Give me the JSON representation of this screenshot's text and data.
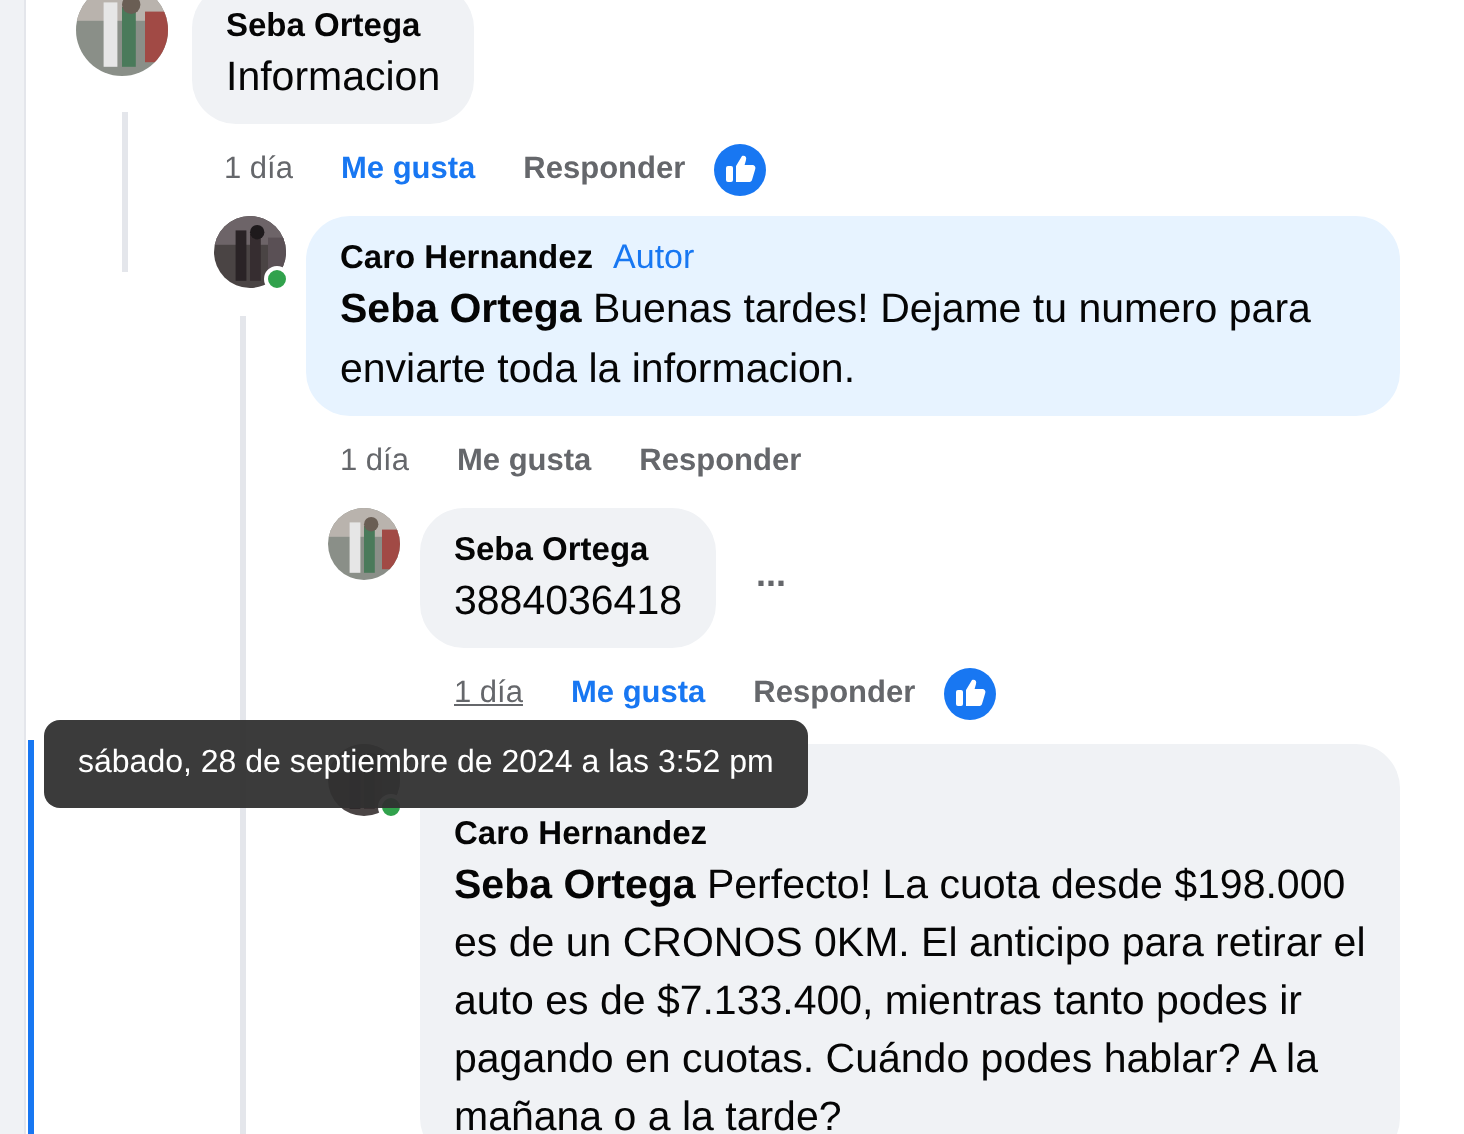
{
  "comments": [
    {
      "author": "Seba Ortega",
      "text": "Informacion",
      "online": false,
      "time": "1 día",
      "time_hover": false,
      "like": "Me gusta",
      "liked": true,
      "reply": "Responder",
      "reaction": true,
      "children": [
        {
          "author": "Caro Hernandez",
          "badge": "Autor",
          "mention": "Seba Ortega",
          "text": "Buenas tardes! Dejame tu numero para enviarte toda la informacion.",
          "online": true,
          "time": "1 día",
          "time_hover": false,
          "like": "Me gusta",
          "liked": false,
          "reply": "Responder",
          "reaction": false,
          "children": [
            {
              "author": "Seba Ortega",
              "text": "3884036418",
              "online": false,
              "time": "1 día",
              "time_hover": true,
              "like": "Me gusta",
              "liked": true,
              "reply": "Responder",
              "reaction": true,
              "more": "..."
            },
            {
              "author": "Caro Hernandez",
              "mention": "Seba Ortega",
              "text": "Perfecto! La cuota desde $198.000 es de un CRONOS 0KM. El anticipo para retirar el auto es de $7.133.400, mientras tanto podes ir pagando en cuotas. Cuándo podes hablar? A la mañana o a la tarde?",
              "online": true,
              "highlighted": true
            }
          ]
        }
      ]
    }
  ],
  "tooltip": "sábado, 28 de septiembre de 2024 a las 3:52 pm"
}
